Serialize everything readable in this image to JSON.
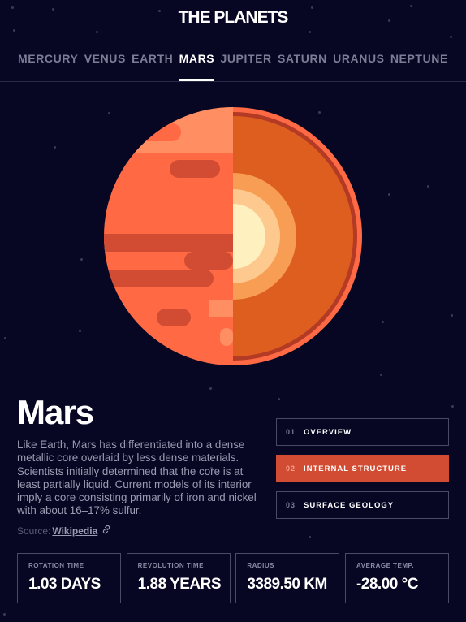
{
  "logo": "THE PLANETS",
  "nav": [
    "MERCURY",
    "VENUS",
    "EARTH",
    "MARS",
    "JUPITER",
    "SATURN",
    "URANUS",
    "NEPTUNE"
  ],
  "nav_active": "MARS",
  "planet": {
    "name": "Mars",
    "description": "Like Earth, Mars has differentiated into a dense metallic core overlaid by less dense materials. Scientists initially determined that the core is at least partially liquid. Current models of its interior imply a core consisting primarily of iron and nickel with about 16–17% sulfur.",
    "source_label": "Source:",
    "source_link": "Wikipedia",
    "source_icon": "external-link-icon",
    "image": "planet-mars-internal-icon"
  },
  "tabs": [
    {
      "num": "01",
      "label": "OVERVIEW",
      "active": false
    },
    {
      "num": "02",
      "label": "INTERNAL STRUCTURE",
      "active": true
    },
    {
      "num": "03",
      "label": "SURFACE GEOLOGY",
      "active": false
    }
  ],
  "stats": [
    {
      "label": "ROTATION TIME",
      "value": "1.03 DAYS"
    },
    {
      "label": "REVOLUTION TIME",
      "value": "1.88 YEARS"
    },
    {
      "label": "RADIUS",
      "value": "3389.50 KM"
    },
    {
      "label": "AVERAGE TEMP.",
      "value": "-28.00 °C"
    }
  ],
  "colors": {
    "background": "#070724",
    "accent": "#D14C32",
    "planet_surface": "#FF6A45",
    "planet_interior": "#DE5E1F"
  }
}
